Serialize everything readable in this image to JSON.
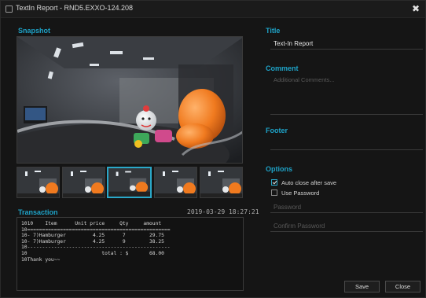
{
  "window": {
    "title": "TextIn Report - RND5.EXXO-124.208",
    "close_glyph": "✖"
  },
  "left": {
    "snapshot_label": "Snapshot",
    "transaction_label": "Transaction",
    "timestamp": "2019-03-29 18:27:21",
    "selected_thumbnail_index": 2,
    "thumbnail_count": 5,
    "receipt_text": "1010    Item      Unit price     Qty     amount\n10================================================\n10- 7)Hamburger         4.25      7        29.75\n10- 7)Hamburger         4.25      9        38.25\n10------------------------------------------------\n10                         total : $       68.00\n10Thank you~~"
  },
  "right": {
    "title_label": "Title",
    "title_value": "Text-In Report",
    "comment_label": "Comment",
    "comment_placeholder": "Additional Comments...",
    "footer_label": "Footer",
    "footer_value": "",
    "options_label": "Options",
    "auto_close_label": "Auto close after save",
    "auto_close_checked": true,
    "use_password_label": "Use Password",
    "use_password_checked": false,
    "password_placeholder": "Password",
    "confirm_password_placeholder": "Confirm Password"
  },
  "buttons": {
    "save": "Save",
    "close": "Close"
  },
  "colors": {
    "accent": "#1ea3c8",
    "background": "#151515",
    "text": "#cfcfcf"
  },
  "icons": {
    "window": "window-app-icon",
    "close": "close-icon",
    "check": "checkmark-icon"
  }
}
